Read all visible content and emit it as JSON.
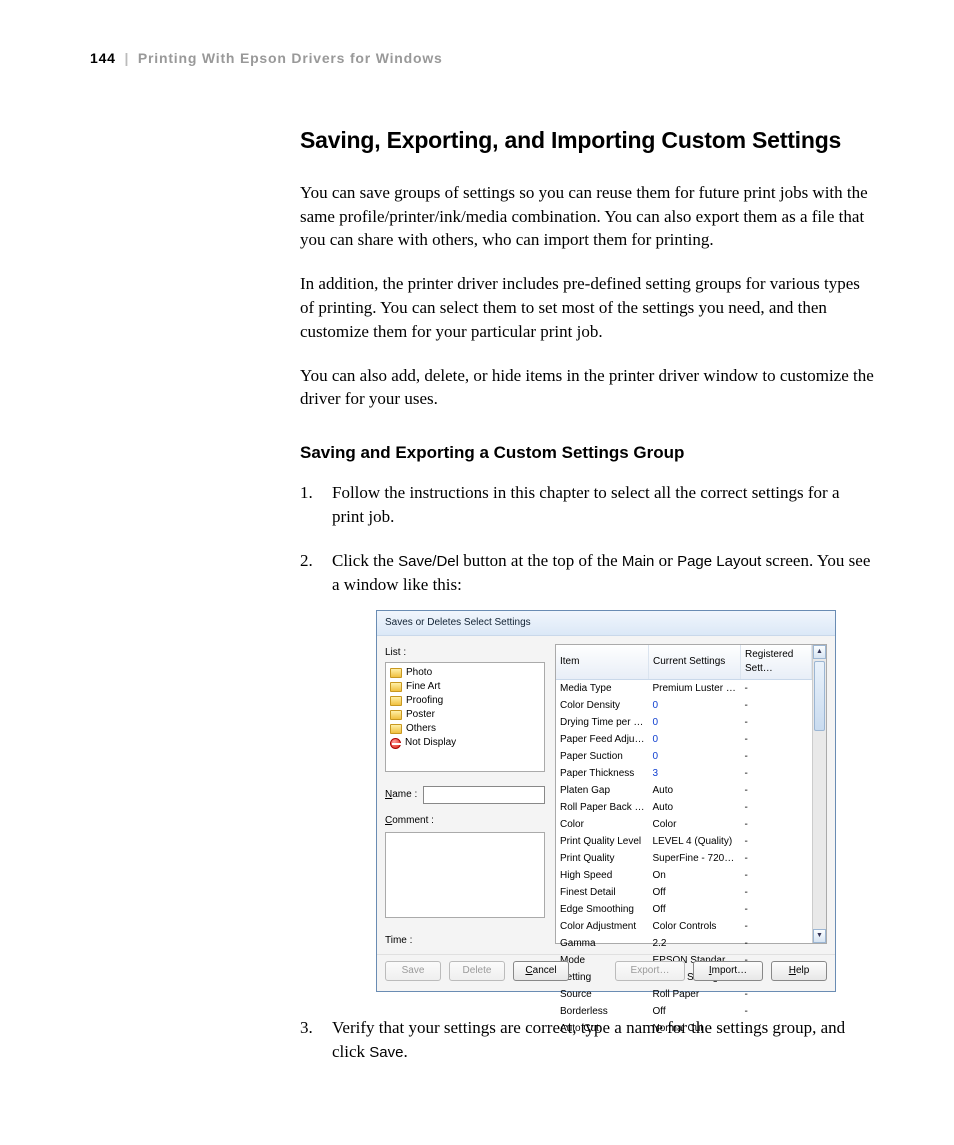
{
  "header": {
    "page_number": "144",
    "separator": "|",
    "section": "Printing With Epson Drivers for Windows"
  },
  "title": "Saving, Exporting, and Importing Custom Settings",
  "paragraphs": {
    "p1": "You can save groups of settings so you can reuse them for future print jobs with the same profile/printer/ink/media combination. You can also export them as a file that you can share with others, who can import them for printing.",
    "p2": "In addition, the printer driver includes pre-defined setting groups for various types of printing. You can select them to set most of the settings you need, and then customize them for your particular print job.",
    "p3": "You can also add, delete, or hide items in the printer driver window to customize the driver for your uses."
  },
  "subhead": "Saving and Exporting a Custom Settings Group",
  "steps": {
    "s1": "Follow the instructions in this chapter to select all the correct settings for a print job.",
    "s2a": "Click the ",
    "s2_btn": "Save/Del",
    "s2b": " button at the top of the ",
    "s2_main": "Main",
    "s2c": " or ",
    "s2_pl": "Page Layout",
    "s2d": " screen. You see a window like this:",
    "s3a": "Verify that your settings are correct, type a name for the settings group, and click ",
    "s3_save": "Save",
    "s3b": "."
  },
  "dialog": {
    "title": "Saves or Deletes Select Settings",
    "labels": {
      "list": "List :",
      "name_u": "N",
      "name_rest": "ame :",
      "comment_u": "C",
      "comment_rest": "omment :",
      "time": "Time :"
    },
    "list_items": [
      "Photo",
      "Fine Art",
      "Proofing",
      "Poster",
      "Others",
      "Not Display"
    ],
    "columns": {
      "item": "Item",
      "current": "Current Settings",
      "registered": "Registered Sett…"
    },
    "rows": [
      {
        "item": "Media Type",
        "current": "Premium Luster …",
        "reg": "-"
      },
      {
        "item": "Color Density",
        "current": "0",
        "reg": "-",
        "blue": true
      },
      {
        "item": "Drying Time per …",
        "current": "0",
        "reg": "-",
        "blue": true
      },
      {
        "item": "Paper Feed Adju…",
        "current": "0",
        "reg": "-",
        "blue": true
      },
      {
        "item": "Paper Suction",
        "current": "0",
        "reg": "-",
        "blue": true
      },
      {
        "item": "Paper Thickness",
        "current": "3",
        "reg": "-",
        "blue": true
      },
      {
        "item": "Platen Gap",
        "current": "Auto",
        "reg": "-"
      },
      {
        "item": "Roll Paper Back …",
        "current": "Auto",
        "reg": "-"
      },
      {
        "item": "Color",
        "current": "Color",
        "reg": "-"
      },
      {
        "item": "Print Quality Level",
        "current": "LEVEL 4 (Quality)",
        "reg": "-"
      },
      {
        "item": "Print Quality",
        "current": "SuperFine - 720…",
        "reg": "-"
      },
      {
        "item": "High Speed",
        "current": "On",
        "reg": "-"
      },
      {
        "item": "Finest Detail",
        "current": "Off",
        "reg": "-"
      },
      {
        "item": "Edge Smoothing",
        "current": "Off",
        "reg": "-"
      },
      {
        "item": "Color Adjustment",
        "current": "Color Controls",
        "reg": "-"
      },
      {
        "item": "Gamma",
        "current": "2.2",
        "reg": "-"
      },
      {
        "item": "Mode",
        "current": "EPSON Standar…",
        "reg": "-"
      },
      {
        "item": "Setting",
        "current": "Default Setting",
        "reg": "-"
      },
      {
        "item": "Source",
        "current": "Roll Paper",
        "reg": "-"
      },
      {
        "item": "Borderless",
        "current": "Off",
        "reg": "-"
      },
      {
        "item": "Auto Cut",
        "current": "Normal Cut",
        "reg": "-"
      }
    ],
    "buttons": {
      "save": "Save",
      "delete": "Delete",
      "cancel": "Cancel",
      "export": "Export…",
      "import": "Import…",
      "help": "Help"
    },
    "cancel_u": "C",
    "cancel_rest": "ancel",
    "import_u": "I",
    "import_rest": "mport…",
    "help_u": "H",
    "help_rest": "elp"
  }
}
